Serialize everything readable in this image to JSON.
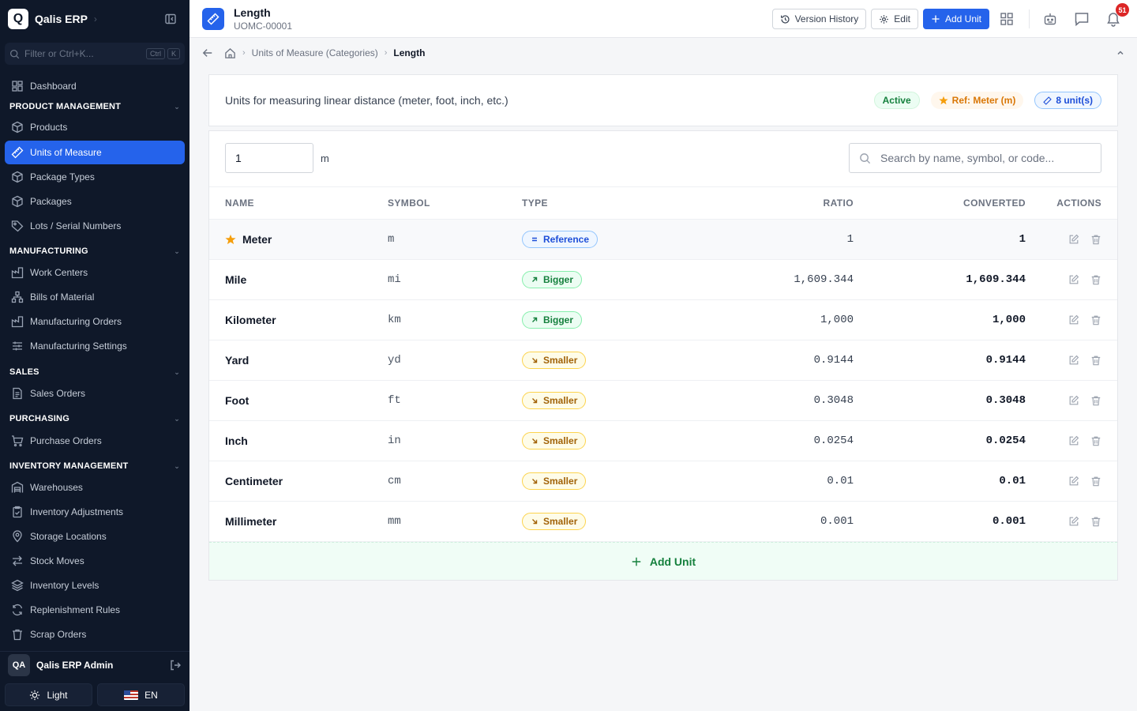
{
  "app": {
    "logo_letter": "Q",
    "name": "Qalis ERP"
  },
  "filter": {
    "placeholder": "Filter or Ctrl+K...",
    "kbd1": "Ctrl",
    "kbd2": "K"
  },
  "nav": {
    "dashboard": "Dashboard",
    "sections": {
      "product": "PRODUCT MANAGEMENT",
      "manufacturing": "MANUFACTURING",
      "sales": "SALES",
      "purchasing": "PURCHASING",
      "inventory": "INVENTORY MANAGEMENT"
    },
    "items": {
      "products": "Products",
      "uom": "Units of Measure",
      "package_types": "Package Types",
      "packages": "Packages",
      "lots": "Lots / Serial Numbers",
      "work_centers": "Work Centers",
      "bom": "Bills of Material",
      "mo": "Manufacturing Orders",
      "mfg_settings": "Manufacturing Settings",
      "sales_orders": "Sales Orders",
      "purchase_orders": "Purchase Orders",
      "warehouses": "Warehouses",
      "inv_adjust": "Inventory Adjustments",
      "storage": "Storage Locations",
      "stock_moves": "Stock Moves",
      "inv_levels": "Inventory Levels",
      "replenish": "Replenishment Rules",
      "scrap": "Scrap Orders"
    }
  },
  "user": {
    "initials": "QA",
    "name": "Qalis ERP Admin"
  },
  "bottom": {
    "theme": "Light",
    "lang": "EN"
  },
  "header": {
    "title": "Length",
    "code": "UOMC-00001",
    "version_history": "Version History",
    "edit": "Edit",
    "add_unit": "Add Unit",
    "notifications": "51"
  },
  "breadcrumb": {
    "parent": "Units of Measure (Categories)",
    "current": "Length"
  },
  "info": {
    "description": "Units for measuring linear distance (meter, foot, inch, etc.)",
    "status": "Active",
    "ref": "Ref: Meter (m)",
    "count": "8 unit(s)"
  },
  "converter": {
    "value": "1",
    "unit": "m",
    "search_placeholder": "Search by name, symbol, or code..."
  },
  "table": {
    "headers": {
      "name": "NAME",
      "symbol": "SYMBOL",
      "type": "TYPE",
      "ratio": "RATIO",
      "converted": "CONVERTED",
      "actions": "ACTIONS"
    },
    "rows": [
      {
        "name": "Meter",
        "symbol": "m",
        "type": "Reference",
        "ratio": "1",
        "converted": "1"
      },
      {
        "name": "Mile",
        "symbol": "mi",
        "type": "Bigger",
        "ratio": "1,609.344",
        "converted": "1,609.344"
      },
      {
        "name": "Kilometer",
        "symbol": "km",
        "type": "Bigger",
        "ratio": "1,000",
        "converted": "1,000"
      },
      {
        "name": "Yard",
        "symbol": "yd",
        "type": "Smaller",
        "ratio": "0.9144",
        "converted": "0.9144"
      },
      {
        "name": "Foot",
        "symbol": "ft",
        "type": "Smaller",
        "ratio": "0.3048",
        "converted": "0.3048"
      },
      {
        "name": "Inch",
        "symbol": "in",
        "type": "Smaller",
        "ratio": "0.0254",
        "converted": "0.0254"
      },
      {
        "name": "Centimeter",
        "symbol": "cm",
        "type": "Smaller",
        "ratio": "0.01",
        "converted": "0.01"
      },
      {
        "name": "Millimeter",
        "symbol": "mm",
        "type": "Smaller",
        "ratio": "0.001",
        "converted": "0.001"
      }
    ],
    "add_unit": "Add Unit"
  },
  "colors": {
    "accent": "#2563eb",
    "sidebar": "#0f1829",
    "success": "#15803d",
    "warning": "#d97706"
  }
}
